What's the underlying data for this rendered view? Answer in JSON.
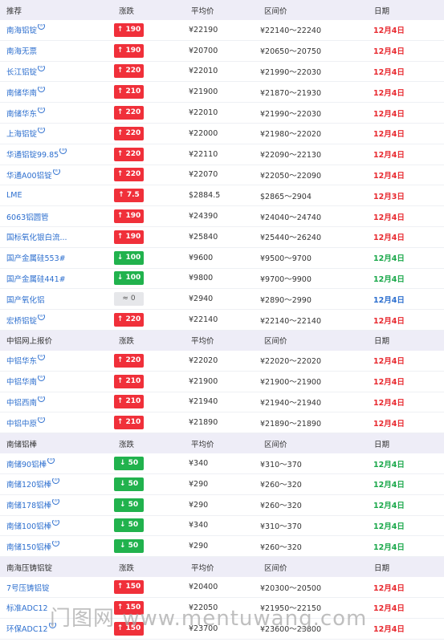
{
  "colors": {
    "up": "#f0303a",
    "down": "#21b24d",
    "flat": "#e6e7ea",
    "name": "#2d6fcf",
    "date_red": "#e8292f",
    "date_green": "#1aa84a",
    "date_blue": "#2d6fcf"
  },
  "columns": {
    "change": "涨跌",
    "avg": "平均价",
    "range": "区间价",
    "date": "日期"
  },
  "watermark": "门图网 www.mentuwang.com",
  "sections": [
    {
      "title": "推荐",
      "rows": [
        {
          "name": "南海铝锭",
          "mark": true,
          "dir": "up",
          "change": "190",
          "avg": "¥22190",
          "range": "¥22140～22240",
          "date": "12月4日",
          "date_color": "red"
        },
        {
          "name": "南海无票",
          "mark": false,
          "dir": "up",
          "change": "190",
          "avg": "¥20700",
          "range": "¥20650～20750",
          "date": "12月4日",
          "date_color": "red"
        },
        {
          "name": "长江铝锭",
          "mark": true,
          "dir": "up",
          "change": "220",
          "avg": "¥22010",
          "range": "¥21990～22030",
          "date": "12月4日",
          "date_color": "red"
        },
        {
          "name": "南储华南",
          "mark": true,
          "dir": "up",
          "change": "210",
          "avg": "¥21900",
          "range": "¥21870～21930",
          "date": "12月4日",
          "date_color": "red"
        },
        {
          "name": "南储华东",
          "mark": true,
          "dir": "up",
          "change": "220",
          "avg": "¥22010",
          "range": "¥21990～22030",
          "date": "12月4日",
          "date_color": "red"
        },
        {
          "name": "上海铝锭",
          "mark": true,
          "dir": "up",
          "change": "220",
          "avg": "¥22000",
          "range": "¥21980～22020",
          "date": "12月4日",
          "date_color": "red"
        },
        {
          "name": "华通铝锭99.85",
          "mark": true,
          "dir": "up",
          "change": "220",
          "avg": "¥22110",
          "range": "¥22090～22130",
          "date": "12月4日",
          "date_color": "red"
        },
        {
          "name": "华通A00铝锭",
          "mark": true,
          "dir": "up",
          "change": "220",
          "avg": "¥22070",
          "range": "¥22050～22090",
          "date": "12月4日",
          "date_color": "red"
        },
        {
          "name": "LME",
          "mark": false,
          "dir": "up",
          "change": "7.5",
          "avg": "$2884.5",
          "range": "$2865～2904",
          "date": "12月3日",
          "date_color": "red"
        },
        {
          "name": "6063铝圆管",
          "mark": false,
          "dir": "up",
          "change": "190",
          "avg": "¥24390",
          "range": "¥24040～24740",
          "date": "12月4日",
          "date_color": "red"
        },
        {
          "name": "国标氧化银白流...",
          "mark": false,
          "dir": "up",
          "change": "190",
          "avg": "¥25840",
          "range": "¥25440～26240",
          "date": "12月4日",
          "date_color": "red"
        },
        {
          "name": "国产金属硅553#",
          "mark": false,
          "dir": "down",
          "change": "100",
          "avg": "¥9600",
          "range": "¥9500～9700",
          "date": "12月4日",
          "date_color": "green"
        },
        {
          "name": "国产金属硅441#",
          "mark": false,
          "dir": "down",
          "change": "100",
          "avg": "¥9800",
          "range": "¥9700～9900",
          "date": "12月4日",
          "date_color": "green"
        },
        {
          "name": "国产氧化铝",
          "mark": false,
          "dir": "flat",
          "change": "0",
          "avg": "¥2940",
          "range": "¥2890～2990",
          "date": "12月4日",
          "date_color": "blue"
        },
        {
          "name": "宏桥铝锭",
          "mark": true,
          "dir": "up",
          "change": "220",
          "avg": "¥22140",
          "range": "¥22140～22140",
          "date": "12月4日",
          "date_color": "red"
        }
      ]
    },
    {
      "title": "中铝网上报价",
      "rows": [
        {
          "name": "中铝华东",
          "mark": true,
          "dir": "up",
          "change": "220",
          "avg": "¥22020",
          "range": "¥22020～22020",
          "date": "12月4日",
          "date_color": "red"
        },
        {
          "name": "中铝华南",
          "mark": true,
          "dir": "up",
          "change": "210",
          "avg": "¥21900",
          "range": "¥21900～21900",
          "date": "12月4日",
          "date_color": "red"
        },
        {
          "name": "中铝西南",
          "mark": true,
          "dir": "up",
          "change": "210",
          "avg": "¥21940",
          "range": "¥21940～21940",
          "date": "12月4日",
          "date_color": "red"
        },
        {
          "name": "中铝中原",
          "mark": true,
          "dir": "up",
          "change": "210",
          "avg": "¥21890",
          "range": "¥21890～21890",
          "date": "12月4日",
          "date_color": "red"
        }
      ]
    },
    {
      "title": "南储铝棒",
      "rows": [
        {
          "name": "南储90铝棒",
          "mark": true,
          "dir": "down",
          "change": "50",
          "avg": "¥340",
          "range": "¥310～370",
          "date": "12月4日",
          "date_color": "green"
        },
        {
          "name": "南储120铝棒",
          "mark": true,
          "dir": "down",
          "change": "50",
          "avg": "¥290",
          "range": "¥260～320",
          "date": "12月4日",
          "date_color": "green"
        },
        {
          "name": "南储178铝棒",
          "mark": true,
          "dir": "down",
          "change": "50",
          "avg": "¥290",
          "range": "¥260～320",
          "date": "12月4日",
          "date_color": "green"
        },
        {
          "name": "南储100铝棒",
          "mark": true,
          "dir": "down",
          "change": "50",
          "avg": "¥340",
          "range": "¥310～370",
          "date": "12月4日",
          "date_color": "green"
        },
        {
          "name": "南储150铝棒",
          "mark": true,
          "dir": "down",
          "change": "50",
          "avg": "¥290",
          "range": "¥260～320",
          "date": "12月4日",
          "date_color": "green"
        }
      ]
    },
    {
      "title": "南海压铸铝锭",
      "rows": [
        {
          "name": "7号压铸铝锭",
          "mark": false,
          "dir": "up",
          "change": "150",
          "avg": "¥20400",
          "range": "¥20300～20500",
          "date": "12月4日",
          "date_color": "red"
        },
        {
          "name": "标准ADC12",
          "mark": false,
          "dir": "up",
          "change": "150",
          "avg": "¥22050",
          "range": "¥21950～22150",
          "date": "12月4日",
          "date_color": "red"
        },
        {
          "name": "环保ADC12",
          "mark": true,
          "dir": "up",
          "change": "150",
          "avg": "¥23700",
          "range": "¥23600～23800",
          "date": "12月4日",
          "date_color": "red"
        }
      ]
    }
  ]
}
